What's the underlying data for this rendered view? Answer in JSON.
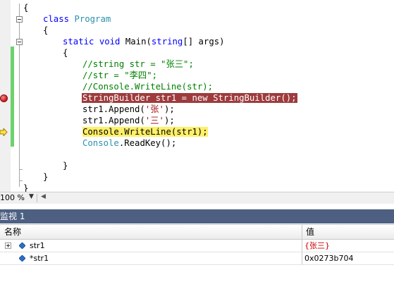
{
  "editor": {
    "lines": {
      "l0": "{",
      "l1_kw": "class",
      "l1_name": "Program",
      "l2": "{",
      "l3_static": "static",
      "l3_void": "void",
      "l3_main": "Main(",
      "l3_string": "string",
      "l3_rest": "[] args)",
      "l4": "{",
      "l5": "//string str = \"张三\";",
      "l6": "//str = \"李四\";",
      "l7": "//Console.WriteLine(str);",
      "l8": "StringBuilder str1 = new StringBuilder();",
      "l9_a": "str1.Append(",
      "l9_s": "'张'",
      "l9_b": ");",
      "l10_a": "str1.Append(",
      "l10_s": "'三'",
      "l10_b": ");",
      "l11": "Console.WriteLine(str1);",
      "l12_ty": "Console",
      "l12_rest": ".ReadKey();",
      "l13": "}",
      "l14": "}",
      "l15": "}"
    },
    "zoom": "100 %"
  },
  "watch": {
    "title": "监视 1",
    "columns": {
      "name": "名称",
      "value": "值"
    },
    "rows": [
      {
        "name": "str1",
        "value": "{张三}",
        "value_color": "#cc0000"
      },
      {
        "name": "*str1",
        "value": "0x0273b704"
      }
    ]
  },
  "colors": {
    "breakpoint_highlight": "#9e3b3d",
    "execution_highlight": "#fff06a",
    "watch_titlebar": "#4d6082"
  },
  "icons": [
    "breakpoint-icon",
    "execution-arrow-icon",
    "expand-icon",
    "variable-icon"
  ]
}
